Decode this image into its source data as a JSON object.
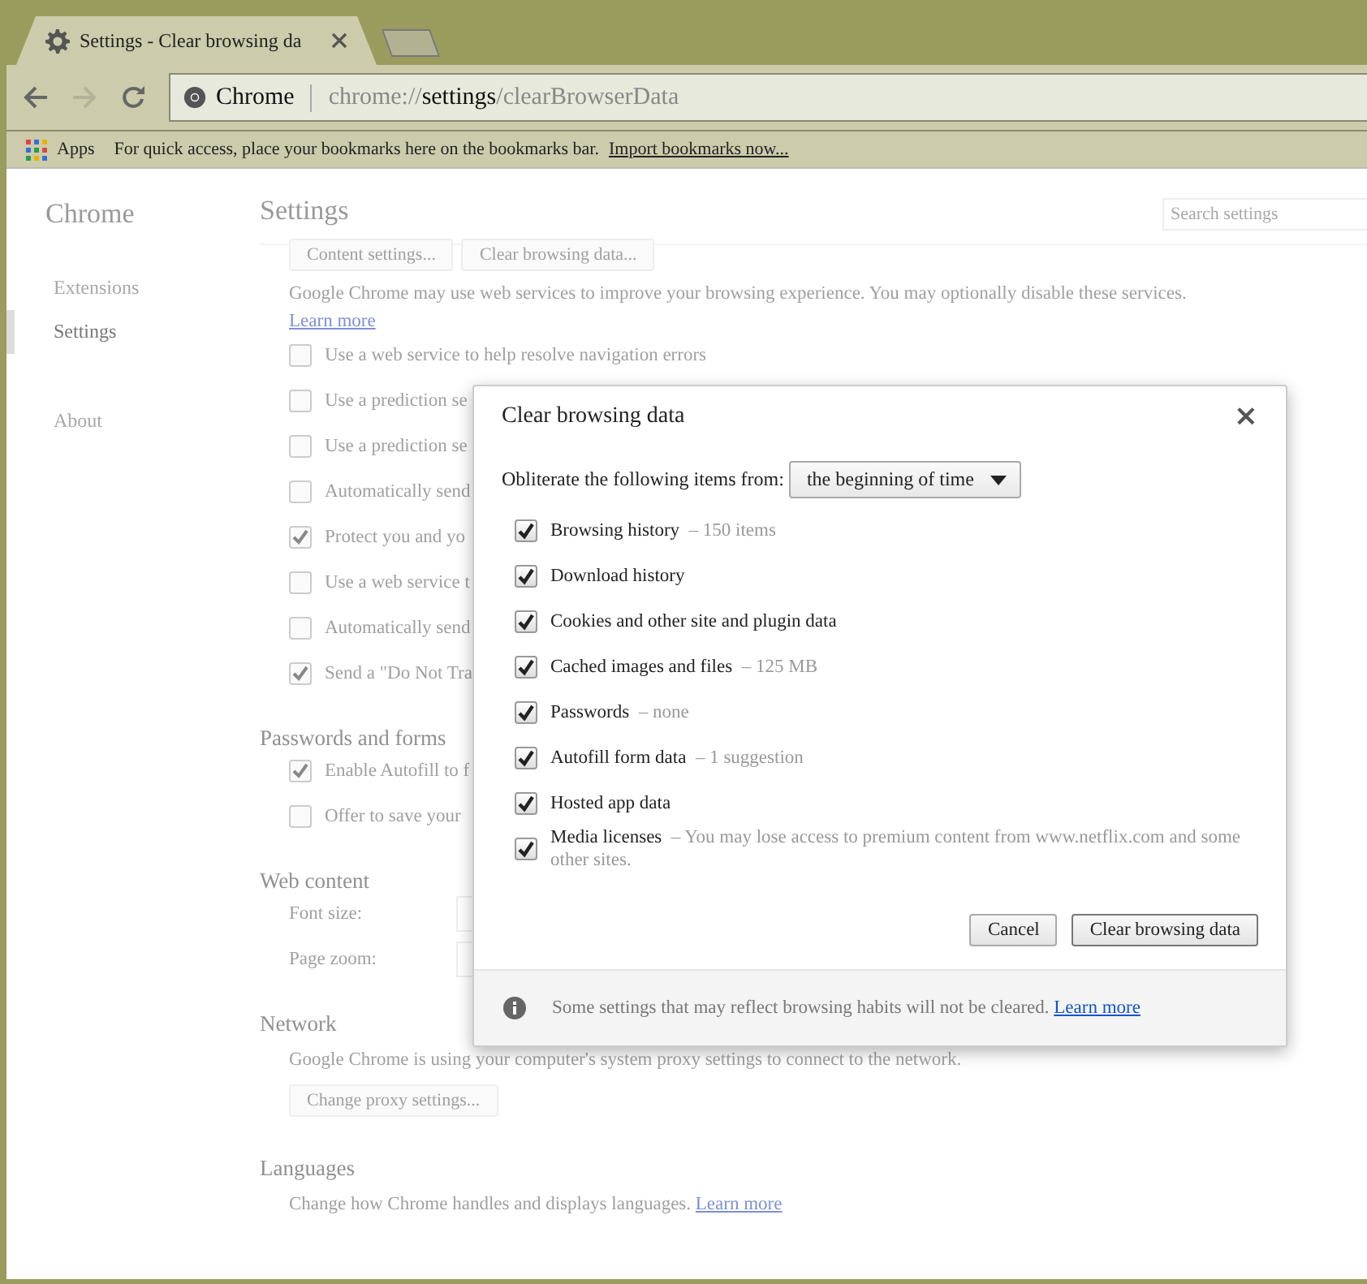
{
  "tab": {
    "title": "Settings - Clear browsing da"
  },
  "omnibox": {
    "site": "Chrome",
    "scheme": "chrome://",
    "host": "settings",
    "path": "/clearBrowserData"
  },
  "bookmarks_bar": {
    "apps": "Apps",
    "message": "For quick access, place your bookmarks here on the bookmarks bar.",
    "link": "Import bookmarks now..."
  },
  "sidebar": {
    "title": "Chrome",
    "items": [
      {
        "label": "Extensions",
        "selected": false
      },
      {
        "label": "Settings",
        "selected": true
      },
      {
        "label": "About",
        "selected": false
      }
    ]
  },
  "settings": {
    "title": "Settings",
    "search": {
      "placeholder": "Search settings"
    },
    "top_buttons": [
      "Content settings...",
      "Clear browsing data..."
    ],
    "privacy_text": "Google Chrome may use web services to improve your browsing experience. You may optionally disable these services.",
    "privacy_link": "Learn more",
    "privacy_rows": [
      {
        "label": "Use a web service to help resolve navigation errors",
        "checked": false
      },
      {
        "label": "Use a prediction se",
        "checked": false
      },
      {
        "label": "Use a prediction se",
        "checked": false
      },
      {
        "label": "Automatically send",
        "checked": false
      },
      {
        "label": "Protect you and yo",
        "checked": true
      },
      {
        "label": "Use a web service t",
        "checked": false
      },
      {
        "label": "Automatically send",
        "checked": false
      },
      {
        "label": "Send a \"Do Not Tra",
        "checked": true
      }
    ],
    "passwords": {
      "title": "Passwords and forms",
      "rows": [
        {
          "label": "Enable Autofill to f",
          "checked": true
        },
        {
          "label": "Offer to save your",
          "checked": false
        }
      ]
    },
    "web_content": {
      "title": "Web content",
      "fields": [
        {
          "label": "Font size:"
        },
        {
          "label": "Page zoom:"
        }
      ]
    },
    "network": {
      "title": "Network",
      "text": "Google Chrome is using your computer's system proxy settings to connect to the network.",
      "button": "Change proxy settings..."
    },
    "languages": {
      "title": "Languages",
      "text": "Change how Chrome handles and displays languages.",
      "link": "Learn more"
    }
  },
  "dialog": {
    "title": "Clear browsing data",
    "close": "×",
    "range_label": "Obliterate the following items from:",
    "range_value": "the beginning of time",
    "items": [
      {
        "label": "Browsing history",
        "detail": "– 150 items",
        "checked": true
      },
      {
        "label": "Download history",
        "checked": true
      },
      {
        "label": "Cookies and other site and plugin data",
        "checked": true
      },
      {
        "label": "Cached images and files",
        "detail": "– 125 MB",
        "checked": true
      },
      {
        "label": "Passwords",
        "detail": "– none",
        "checked": true
      },
      {
        "label": "Autofill form data",
        "detail": "– 1 suggestion",
        "checked": true
      },
      {
        "label": "Hosted app data",
        "checked": true
      },
      {
        "label": "Media licenses",
        "detail": "– You may lose access to premium content from www.netflix.com and some other sites.",
        "checked": true
      }
    ],
    "cancel": "Cancel",
    "confirm": "Clear browsing data",
    "footer_text": "Some settings that may reflect browsing habits will not be cleared.",
    "footer_link": "Learn more"
  }
}
